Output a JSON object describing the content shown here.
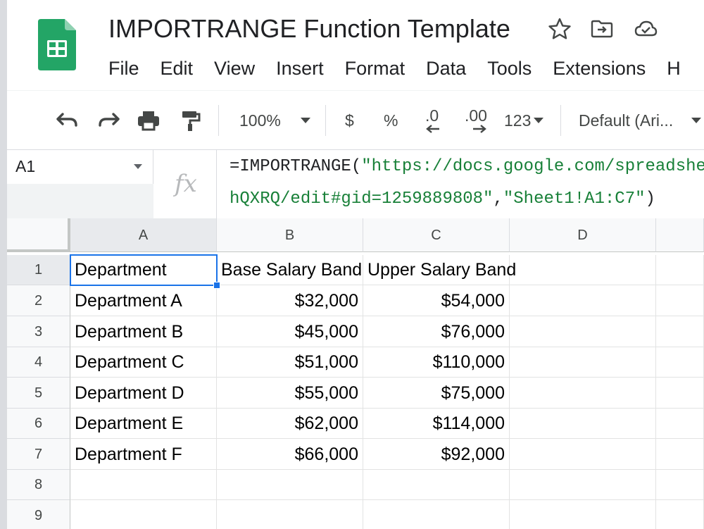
{
  "document": {
    "title": "IMPORTRANGE Function Template"
  },
  "menu": [
    "File",
    "Edit",
    "View",
    "Insert",
    "Format",
    "Data",
    "Tools",
    "Extensions",
    "H"
  ],
  "toolbar": {
    "zoom": "100%",
    "currency": "$",
    "percent": "%",
    "decrease_decimals": ".0",
    "increase_decimals": ".00",
    "more_formats": "123",
    "font": "Default (Ari..."
  },
  "formula_bar": {
    "cell_ref": "A1",
    "fx_label": "fx",
    "line1_prefix": "=IMPORTRANGE(",
    "line1_string": "\"https://docs.google.com/spreadshe",
    "line2_string1": "hQXRQ/edit#gid=1259889808\"",
    "line2_comma": ",",
    "line2_string2": "\"Sheet1!A1:C7\"",
    "line2_close": ")"
  },
  "grid": {
    "columns": [
      "A",
      "B",
      "C",
      "D"
    ],
    "rows": [
      "1",
      "2",
      "3",
      "4",
      "5",
      "6",
      "7",
      "8",
      "9"
    ],
    "cells": [
      [
        "Department",
        "Base Salary Band",
        "Upper Salary Band",
        ""
      ],
      [
        "Department A",
        "$32,000",
        "$54,000",
        ""
      ],
      [
        "Department B",
        "$45,000",
        "$76,000",
        ""
      ],
      [
        "Department C",
        "$51,000",
        "$110,000",
        ""
      ],
      [
        "Department D",
        "$55,000",
        "$75,000",
        ""
      ],
      [
        "Department E",
        "$62,000",
        "$114,000",
        ""
      ],
      [
        "Department F",
        "$66,000",
        "$92,000",
        ""
      ],
      [
        "",
        "",
        "",
        ""
      ],
      [
        "",
        "",
        "",
        ""
      ]
    ],
    "selected_cell": "A1"
  },
  "colors": {
    "sheets_green": "#23a566",
    "selection_blue": "#1a73e8",
    "formula_string_green": "#188038"
  }
}
